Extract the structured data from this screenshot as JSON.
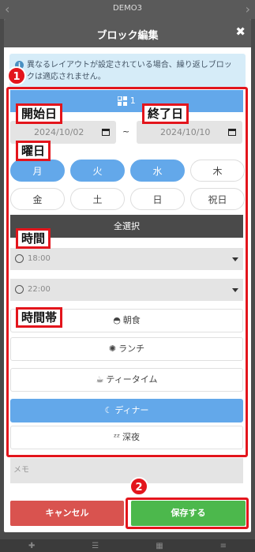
{
  "background": {
    "title": "DEMO3"
  },
  "modal": {
    "title": "ブロック編集",
    "close_icon": "close-icon"
  },
  "info": {
    "text": "異なるレイアウトが設定されている場合、繰り返しブロックは適応されません。"
  },
  "tab": {
    "label": "1",
    "icon": "grid-icon"
  },
  "dates": {
    "start": "2024/10/02",
    "end": "2024/10/10",
    "separator": "~"
  },
  "days": [
    {
      "label": "月",
      "selected": true
    },
    {
      "label": "火",
      "selected": true
    },
    {
      "label": "水",
      "selected": true
    },
    {
      "label": "木",
      "selected": false
    },
    {
      "label": "金",
      "selected": false
    },
    {
      "label": "土",
      "selected": false
    },
    {
      "label": "日",
      "selected": false
    },
    {
      "label": "祝日",
      "selected": false
    }
  ],
  "select_all_label": "全選択",
  "times": {
    "start": "18:00",
    "end": "22:00"
  },
  "timezones": [
    {
      "label": "朝食",
      "icon": "sunrise-icon",
      "glyph": "◓",
      "selected": false
    },
    {
      "label": "ランチ",
      "icon": "sun-icon",
      "glyph": "✺",
      "selected": false
    },
    {
      "label": "ティータイム",
      "icon": "tea-cup-icon",
      "glyph": "☕",
      "selected": false
    },
    {
      "label": "ディナー",
      "icon": "moon-icon",
      "glyph": "☾",
      "selected": true
    },
    {
      "label": "深夜",
      "icon": "sleep-icon",
      "glyph": "ᶻᶻ",
      "selected": false
    }
  ],
  "memo_placeholder": "メモ",
  "buttons": {
    "cancel": "キャンセル",
    "save": "保存する"
  },
  "annotations": {
    "badge1": "1",
    "badge2": "2",
    "start_date": "開始日",
    "end_date": "終了日",
    "weekday": "曜日",
    "time": "時間",
    "timezone": "時間帯"
  },
  "colors": {
    "accent": "#63a8ea",
    "annotation": "#e3151c",
    "cancel": "#d9534f",
    "save": "#4cb84c",
    "header": "#5a5a5a"
  }
}
